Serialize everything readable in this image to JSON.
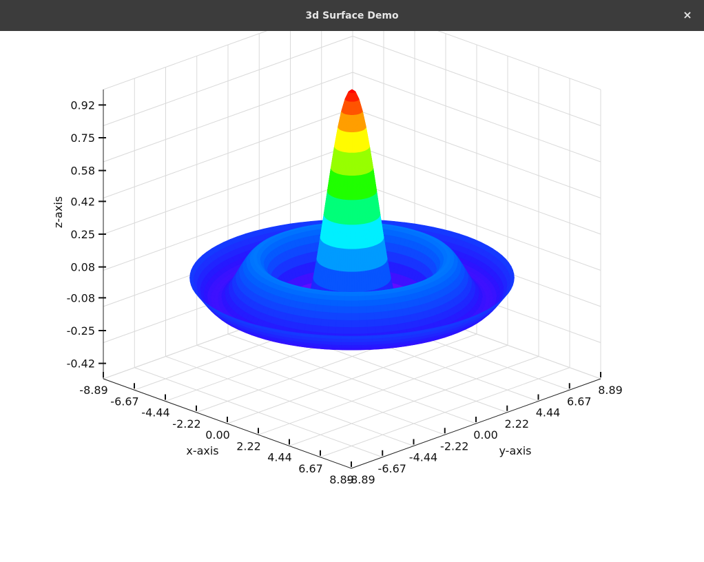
{
  "window": {
    "title": "3d Surface Demo",
    "close_glyph": "×"
  },
  "chart_data": {
    "type": "surface",
    "function": "sinc of radius: sin(r)/r",
    "xlabel": "x-axis",
    "ylabel": "y-axis",
    "zlabel": "z-axis",
    "xlim": [
      -8.89,
      8.89
    ],
    "ylim": [
      -8.89,
      8.89
    ],
    "zlim": [
      -0.5,
      1.0
    ],
    "x_ticks": [
      "-8.89",
      "-6.67",
      "-4.44",
      "-2.22",
      "0.00",
      "2.22",
      "4.44",
      "6.67",
      "8.89"
    ],
    "y_ticks": [
      "-8.89",
      "-6.67",
      "-4.44",
      "-2.22",
      "0.00",
      "2.22",
      "4.44",
      "6.67",
      "8.89"
    ],
    "z_ticks": [
      "-0.42",
      "-0.25",
      "-0.08",
      "0.08",
      "0.25",
      "0.42",
      "0.58",
      "0.75",
      "0.92"
    ],
    "grid": true,
    "colormap": "rainbow (purple → blue → cyan → green → yellow → red)"
  },
  "icons": {
    "close": "close-icon"
  }
}
